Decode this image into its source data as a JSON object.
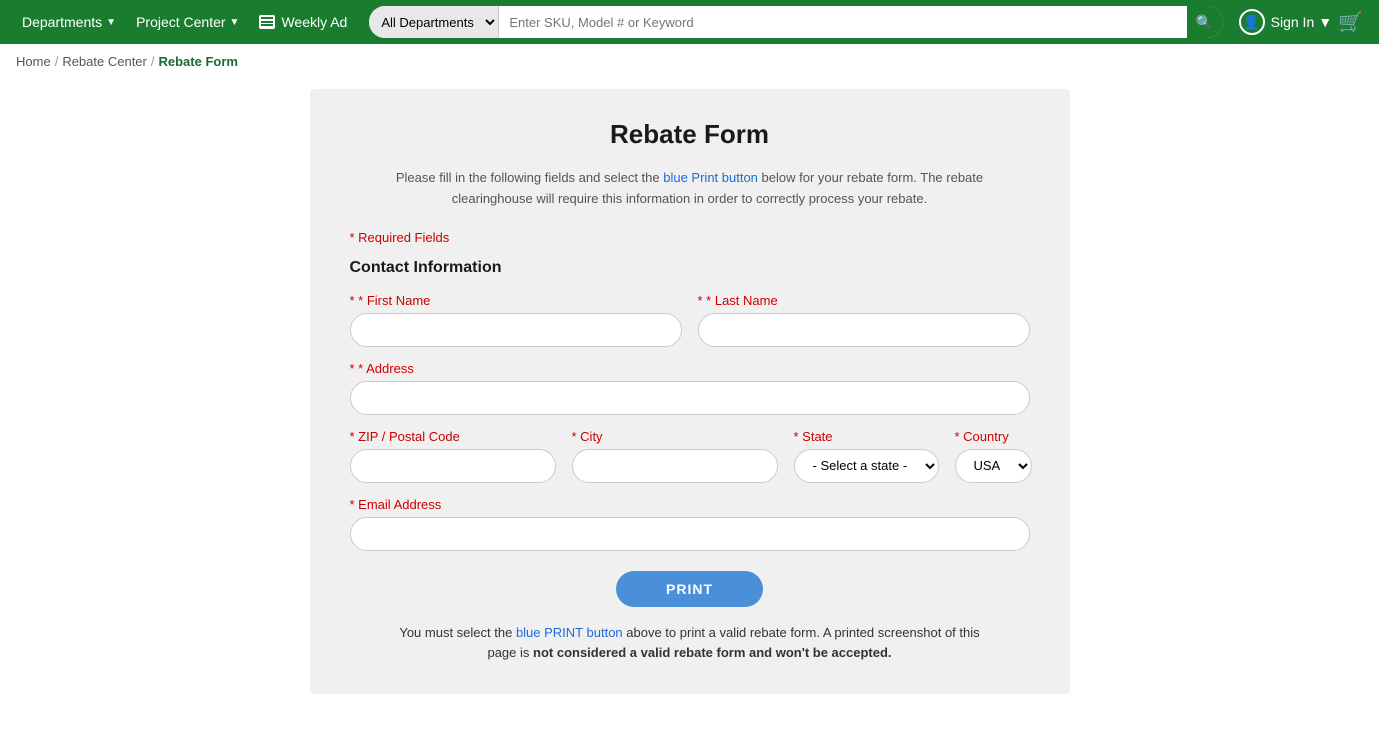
{
  "header": {
    "departments_label": "Departments",
    "project_center_label": "Project Center",
    "weekly_ad_label": "Weekly Ad",
    "search_placeholder": "Enter SKU, Model # or Keyword",
    "search_dept_default": "All Departments",
    "sign_in_label": "Sign In"
  },
  "breadcrumb": {
    "home_label": "Home",
    "rebate_center_label": "Rebate Center",
    "current_label": "Rebate Form"
  },
  "form": {
    "title": "Rebate Form",
    "description_part1": "Please fill in the following fields and select the blue Print button below for your rebate form. The rebate clearinghouse will require this information in order to correctly process your rebate.",
    "required_note": "* Required Fields",
    "contact_section_title": "Contact Information",
    "first_name_label": "* First Name",
    "last_name_label": "* Last Name",
    "address_label": "* Address",
    "zip_label": "* ZIP / Postal Code",
    "city_label": "* City",
    "state_label": "* State",
    "state_default": "- Select a state -",
    "country_label": "* Country",
    "country_default": "USA",
    "email_label": "* Email Address",
    "print_btn_label": "PRINT",
    "footer_note": "You must select the blue PRINT button above to print a valid rebate form. A printed screenshot of this page is not considered a valid rebate form and won't be accepted."
  }
}
